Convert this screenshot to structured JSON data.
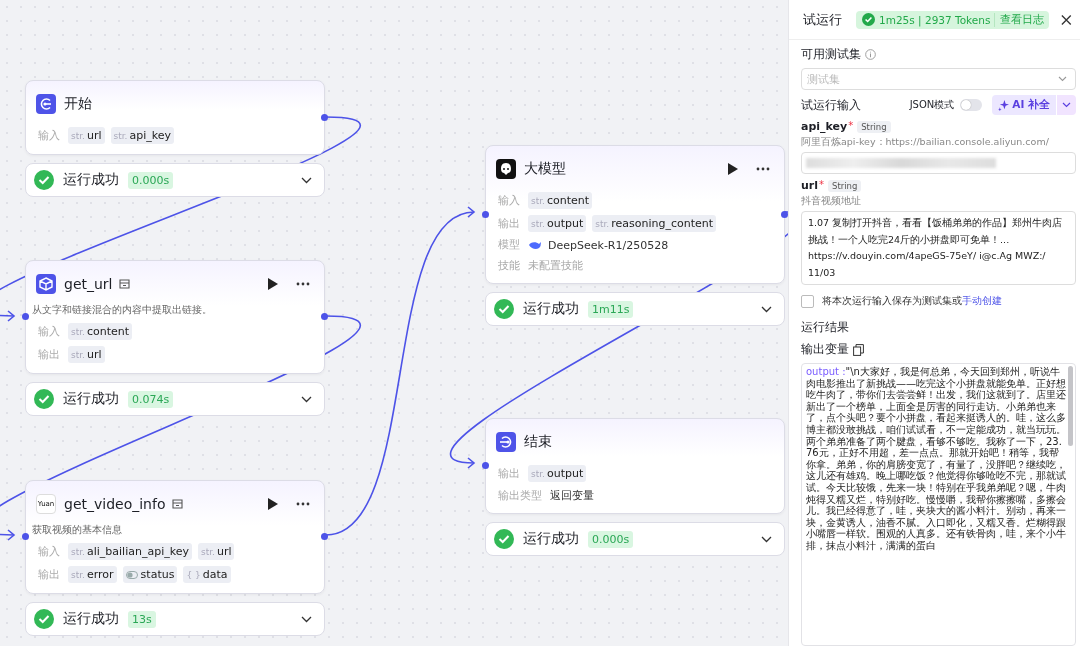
{
  "canvas": {
    "nodes": [
      {
        "kind": "start",
        "title": "开始",
        "rows": [
          {
            "kind": "params",
            "label": "输入",
            "params": [
              {
                "kind": "str",
                "type_label": "str.",
                "name": "url"
              },
              {
                "kind": "str",
                "type_label": "str.",
                "name": "api_key"
              }
            ]
          }
        ],
        "status": {
          "text": "运行成功",
          "time": "0.000s"
        }
      },
      {
        "kind": "plugin",
        "title": "get_url",
        "description": "从文字和链接混合的内容中提取出链接。",
        "rows": [
          {
            "kind": "params",
            "label": "输入",
            "params": [
              {
                "kind": "str",
                "type_label": "str.",
                "name": "content"
              }
            ]
          },
          {
            "kind": "params",
            "label": "输出",
            "params": [
              {
                "kind": "str",
                "type_label": "str.",
                "name": "url"
              }
            ]
          }
        ],
        "status": {
          "text": "运行成功",
          "time": "0.074s"
        }
      },
      {
        "kind": "plugin",
        "icon_text": "Yuan",
        "title": "get_video_info",
        "description": "获取视频的基本信息",
        "rows": [
          {
            "kind": "params",
            "label": "输入",
            "params": [
              {
                "kind": "str",
                "type_label": "str.",
                "name": "ali_bailian_api_key"
              },
              {
                "kind": "str",
                "type_label": "str.",
                "name": "url"
              }
            ]
          },
          {
            "kind": "params",
            "label": "输出",
            "params": [
              {
                "kind": "str",
                "type_label": "str.",
                "name": "error"
              },
              {
                "kind": "bool",
                "name": "status"
              },
              {
                "kind": "obj",
                "type_label": "{ }",
                "name": "data"
              }
            ]
          }
        ],
        "status": {
          "text": "运行成功",
          "time": "13s"
        }
      },
      {
        "kind": "llm",
        "title": "大模型",
        "rows": [
          {
            "kind": "params",
            "label": "输入",
            "params": [
              {
                "kind": "str",
                "type_label": "str.",
                "name": "content"
              }
            ]
          },
          {
            "kind": "params",
            "label": "输出",
            "params": [
              {
                "kind": "str",
                "type_label": "str.",
                "name": "output"
              },
              {
                "kind": "str",
                "type_label": "str.",
                "name": "reasoning_content"
              }
            ]
          },
          {
            "kind": "model",
            "label": "模型",
            "value": "DeepSeek-R1/250528"
          },
          {
            "kind": "muted",
            "label": "技能",
            "value": "未配置技能"
          }
        ],
        "status": {
          "text": "运行成功",
          "time": "1m11s"
        }
      },
      {
        "kind": "end",
        "title": "结束",
        "rows": [
          {
            "kind": "params",
            "label": "输出",
            "params": [
              {
                "kind": "str",
                "type_label": "str.",
                "name": "output"
              }
            ]
          },
          {
            "kind": "text",
            "label": "输出类型",
            "value": "返回变量"
          }
        ],
        "status": {
          "text": "运行成功",
          "time": "0.000s"
        }
      }
    ]
  },
  "panel": {
    "title": "试运行",
    "run_badge": {
      "summary": "1m25s | 2937 Tokens",
      "log_link": "查看日志"
    },
    "testset": {
      "label": "可用测试集",
      "placeholder": "测试集"
    },
    "input_section": {
      "title": "试运行输入",
      "json_mode": {
        "label": "JSON模式",
        "on": false
      },
      "ai_button": "AI 补全"
    },
    "fields": [
      {
        "kind": "input",
        "name": "api_key",
        "type": "String",
        "required_mark": "*",
        "hint": "阿里百炼api-key：https://bailian.console.aliyun.com/",
        "obscured": true
      },
      {
        "kind": "textarea",
        "name": "url",
        "type": "String",
        "required_mark": "*",
        "hint": "抖音视频地址",
        "value": "1.07 复制打开抖音，看看【饭桶弟弟的作品】郑州牛肉店挑战！一个人吃完24斤的小拼盘即可免单！... https://v.douyin.com/4apeGS-75eY/ i@c.Ag MWZ:/ 11/03"
      }
    ],
    "save": {
      "checked": false,
      "text": "将本次运行输入保存为测试集或",
      "link": "手动创建"
    },
    "result": {
      "title": "运行结果",
      "output_title": "输出变量",
      "key": "output :",
      "value": "\"\\n大家好，我是何总弟，今天回到郑州，听说牛肉电影推出了新挑战——吃完这个小拼盘就能免单。正好想吃牛肉了，带你们去尝尝鲜！出发，我们这就到了。店里还新出了一个榜单，上面全是厉害的同行走访。小弟弟也来了，点个头吧？要个小拼盘，看起来挺诱人的。哇，这么多博主都没敢挑战，咱们试试看，不一定能成功，就当玩玩。两个弟弟准备了两个腱盘，看够不够吃。我称了一下，23.76元，正好不用超，差一点点。那就开始吧！稍等，我帮你拿。弟弟，你的肩膀变宽了，有量了，没胖吧？继续吃，这儿还有雄鸡。晚上哪吃饭？他觉得你够呛吃不完，那就试试。今天比较饿，先来一块！特别在乎我弟弟呢？嗯，牛肉炖得又糯又烂，特别好吃。慢慢嚼，我帮你擦擦嘴，多擦会儿。我已经得意了，哇，夹块大的酱小料汁。别动，再来一块，金黄诱人，油香不腻。入口即化，又糯又香。烂糊得跟小嘴唇一样软。围观的人真多。还有铁骨肉，哇，来个小牛排，抹点小料汁，满满的蛋白"
    }
  }
}
